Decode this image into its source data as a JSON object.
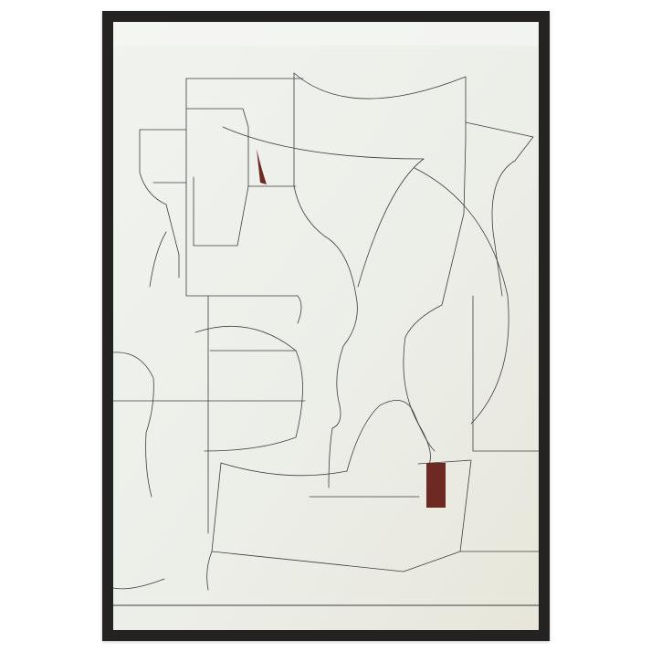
{
  "artwork": {
    "frame_color": "#242322",
    "canvas_color": "#eef0ec",
    "line_color": "#3b3f40",
    "accent_color": "#6e2a22"
  }
}
